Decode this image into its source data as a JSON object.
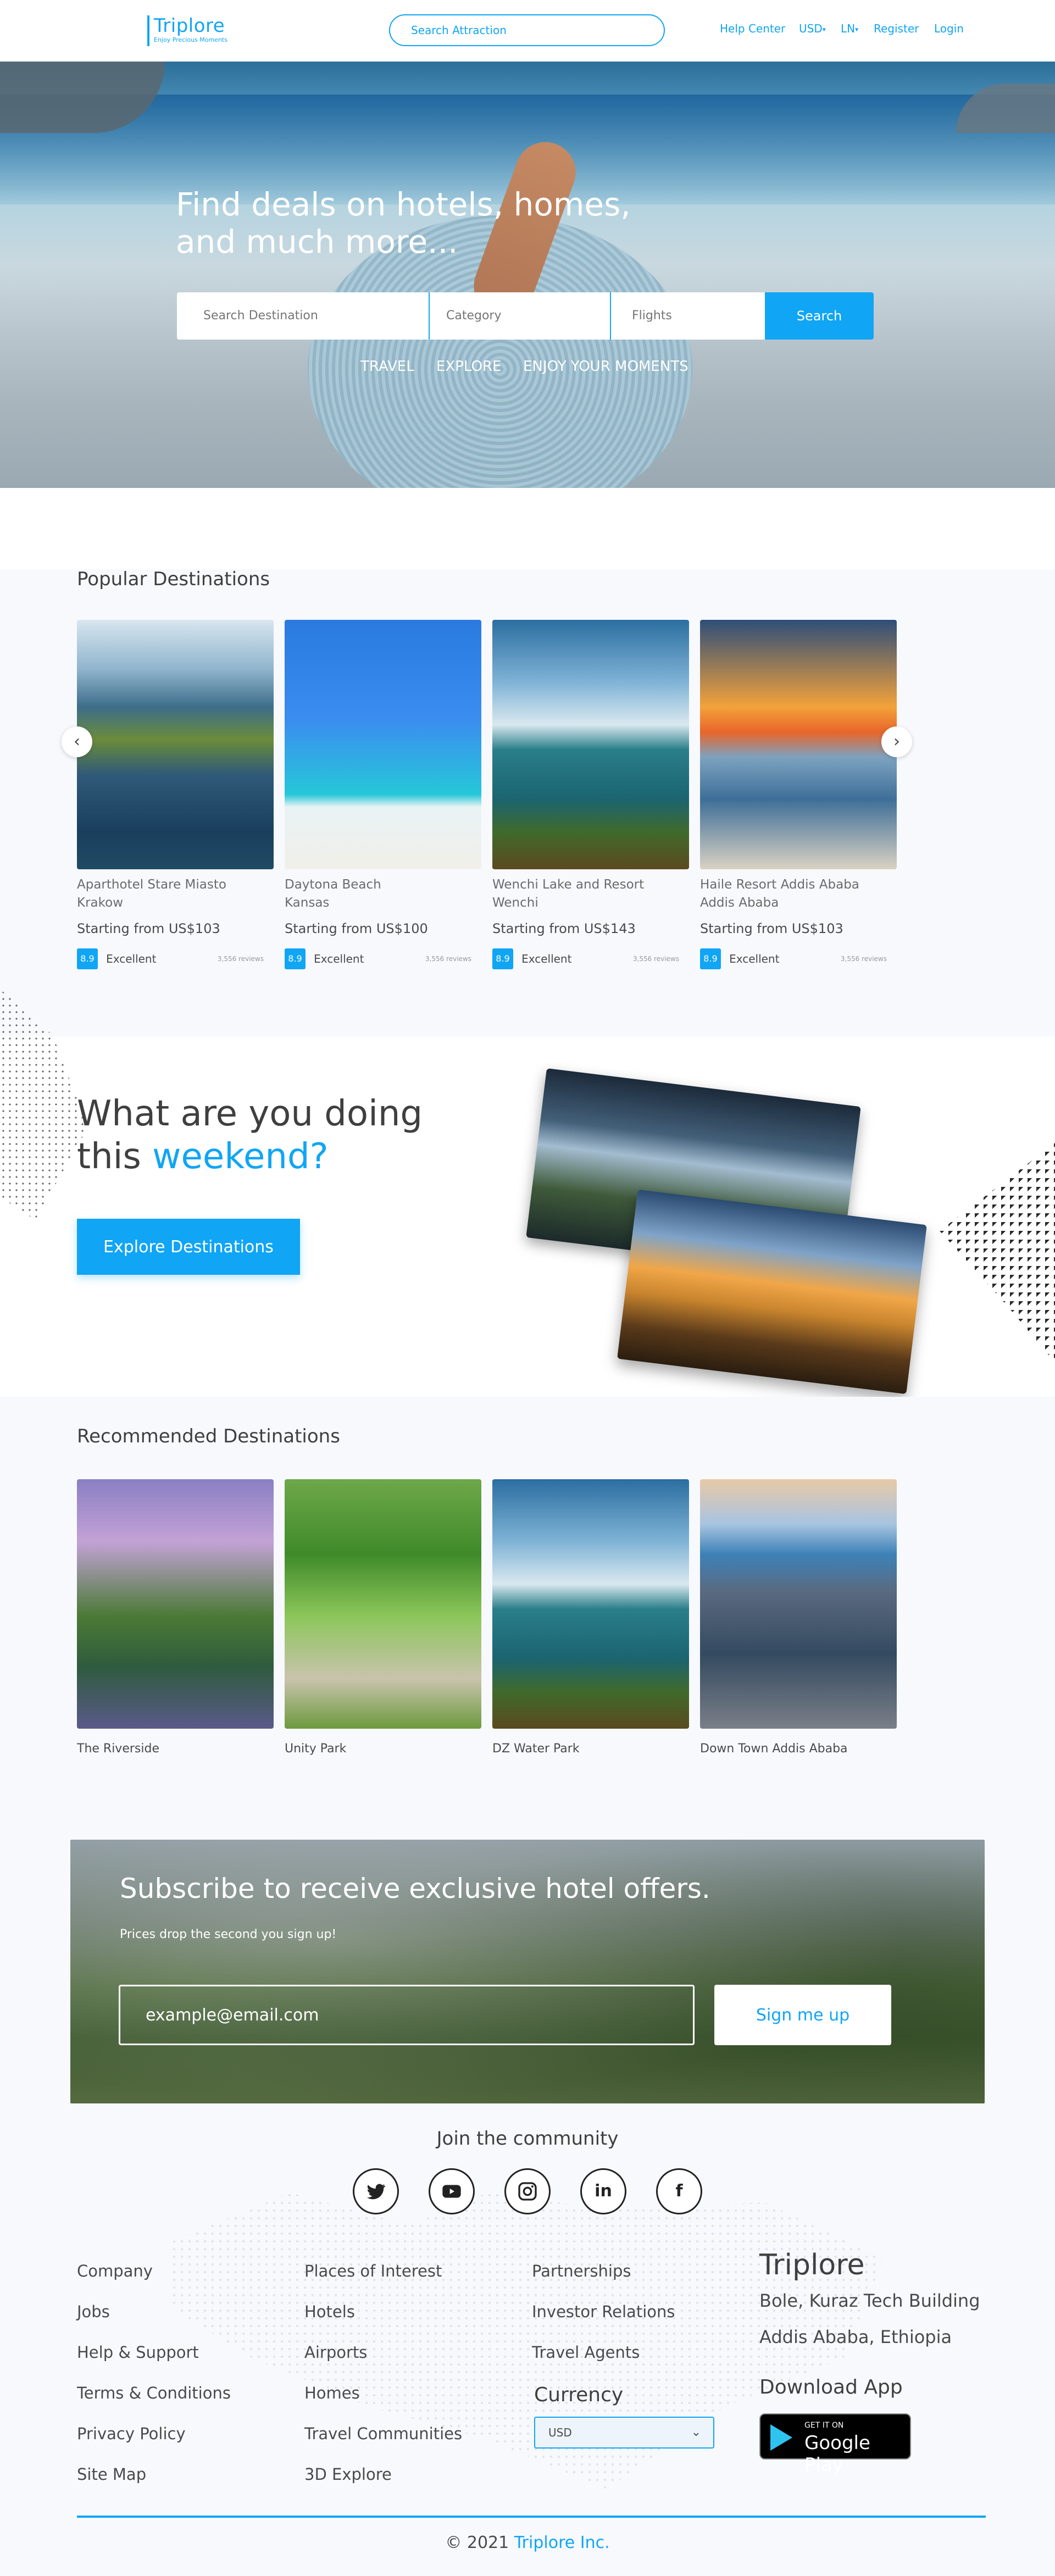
{
  "header": {
    "logo_name": "Triplore",
    "logo_tagline": "Enjoy Precious Moments",
    "search_placeholder": "Search Attraction",
    "nav": {
      "help": "Help Center",
      "currency": "USD",
      "language": "LN",
      "register": "Register",
      "login": "Login"
    }
  },
  "hero": {
    "title_line1": "Find deals on hotels, homes,",
    "title_line2": "and much more...",
    "search": {
      "destination_placeholder": "Search Destination",
      "category_placeholder": "Category",
      "flights_placeholder": "Flights",
      "button": "Search"
    },
    "links": [
      "TRAVEL",
      "EXPLORE",
      "ENJOY YOUR MOMENTS"
    ]
  },
  "popular": {
    "title": "Popular Destinations",
    "cards": [
      {
        "name": "Aparthotel Stare Miasto",
        "location": "Krakow",
        "price": "Starting from US$103",
        "score": "8.9",
        "rating": "Excellent",
        "reviews": "3,556 reviews"
      },
      {
        "name": "Daytona Beach",
        "location": "Kansas",
        "price": "Starting from US$100",
        "score": "8.9",
        "rating": "Excellent",
        "reviews": "3,556 reviews"
      },
      {
        "name": "Wenchi Lake and Resort",
        "location": "Wenchi",
        "price": "Starting from US$143",
        "score": "8.9",
        "rating": "Excellent",
        "reviews": "3,556 reviews"
      },
      {
        "name": "Haile Resort Addis Ababa",
        "location": "Addis Ababa",
        "price": "Starting from US$103",
        "score": "8.9",
        "rating": "Excellent",
        "reviews": "3,556 reviews"
      }
    ]
  },
  "weekend": {
    "line1": "What are you doing",
    "line2_plain": "this ",
    "line2_accent": "weekend?",
    "button": "Explore Destinations"
  },
  "recommended": {
    "title": "Recommended Destinations",
    "items": [
      "The Riverside",
      "Unity Park",
      "DZ Water Park",
      "Down Town Addis Ababa"
    ]
  },
  "subscribe": {
    "title": "Subscribe to receive exclusive hotel offers.",
    "subtitle": "Prices drop the second you sign up!",
    "email_placeholder": "example@email.com",
    "button": "Sign me up"
  },
  "community": {
    "title": "Join the community",
    "social": [
      "twitter-icon",
      "youtube-icon",
      "instagram-icon",
      "linkedin-icon",
      "facebook-icon"
    ]
  },
  "footer": {
    "col1": [
      "Company",
      "Jobs",
      "Help & Support",
      "Terms & Conditions",
      "Privacy Policy",
      "Site Map"
    ],
    "col2": [
      "Places of Interest",
      "Hotels",
      "Airports",
      "Homes",
      "Travel Communities",
      "3D Explore"
    ],
    "col3": [
      "Partnerships",
      "Investor Relations",
      "Travel Agents"
    ],
    "currency_label": "Currency",
    "currency_value": "USD",
    "brand": "Triplore",
    "address_line1": "Bole, Kuraz Tech Building",
    "address_line2": "Addis Ababa, Ethiopia",
    "download_title": "Download App",
    "store_small": "GET IT ON",
    "store_big": "Google Play",
    "copyright_prefix": "© 2021 ",
    "copyright_brand": "Triplore Inc."
  },
  "colors": {
    "accent": "#10a5f5",
    "section_bg": "#f7f9fd"
  }
}
